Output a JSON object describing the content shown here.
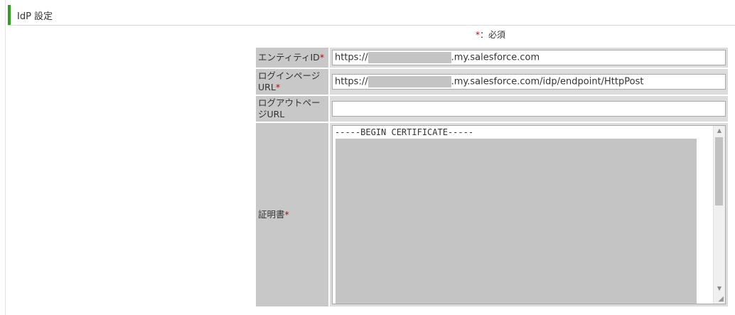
{
  "section": {
    "title": "IdP 設定"
  },
  "required_note": {
    "star": "*",
    "text": "：必須"
  },
  "fields": {
    "entity_id": {
      "label": "エンティティID",
      "req": "*",
      "prefix": "https://",
      "suffix": ".my.salesforce.com"
    },
    "login_url": {
      "label": "ログインページURL",
      "req": "*",
      "prefix": "https://",
      "suffix": ".my.salesforce.com/idp/endpoint/HttpPost"
    },
    "logout_url": {
      "label": "ログアウトページURL",
      "req": "",
      "value": ""
    },
    "certificate": {
      "label": "証明書",
      "req": "*",
      "first_line": "-----BEGIN CERTIFICATE-----"
    }
  },
  "colors": {
    "accent": "#2ca01c",
    "required": "#cc0000",
    "label_bg": "#c8c8c8",
    "mask": "#c4c4c4"
  }
}
